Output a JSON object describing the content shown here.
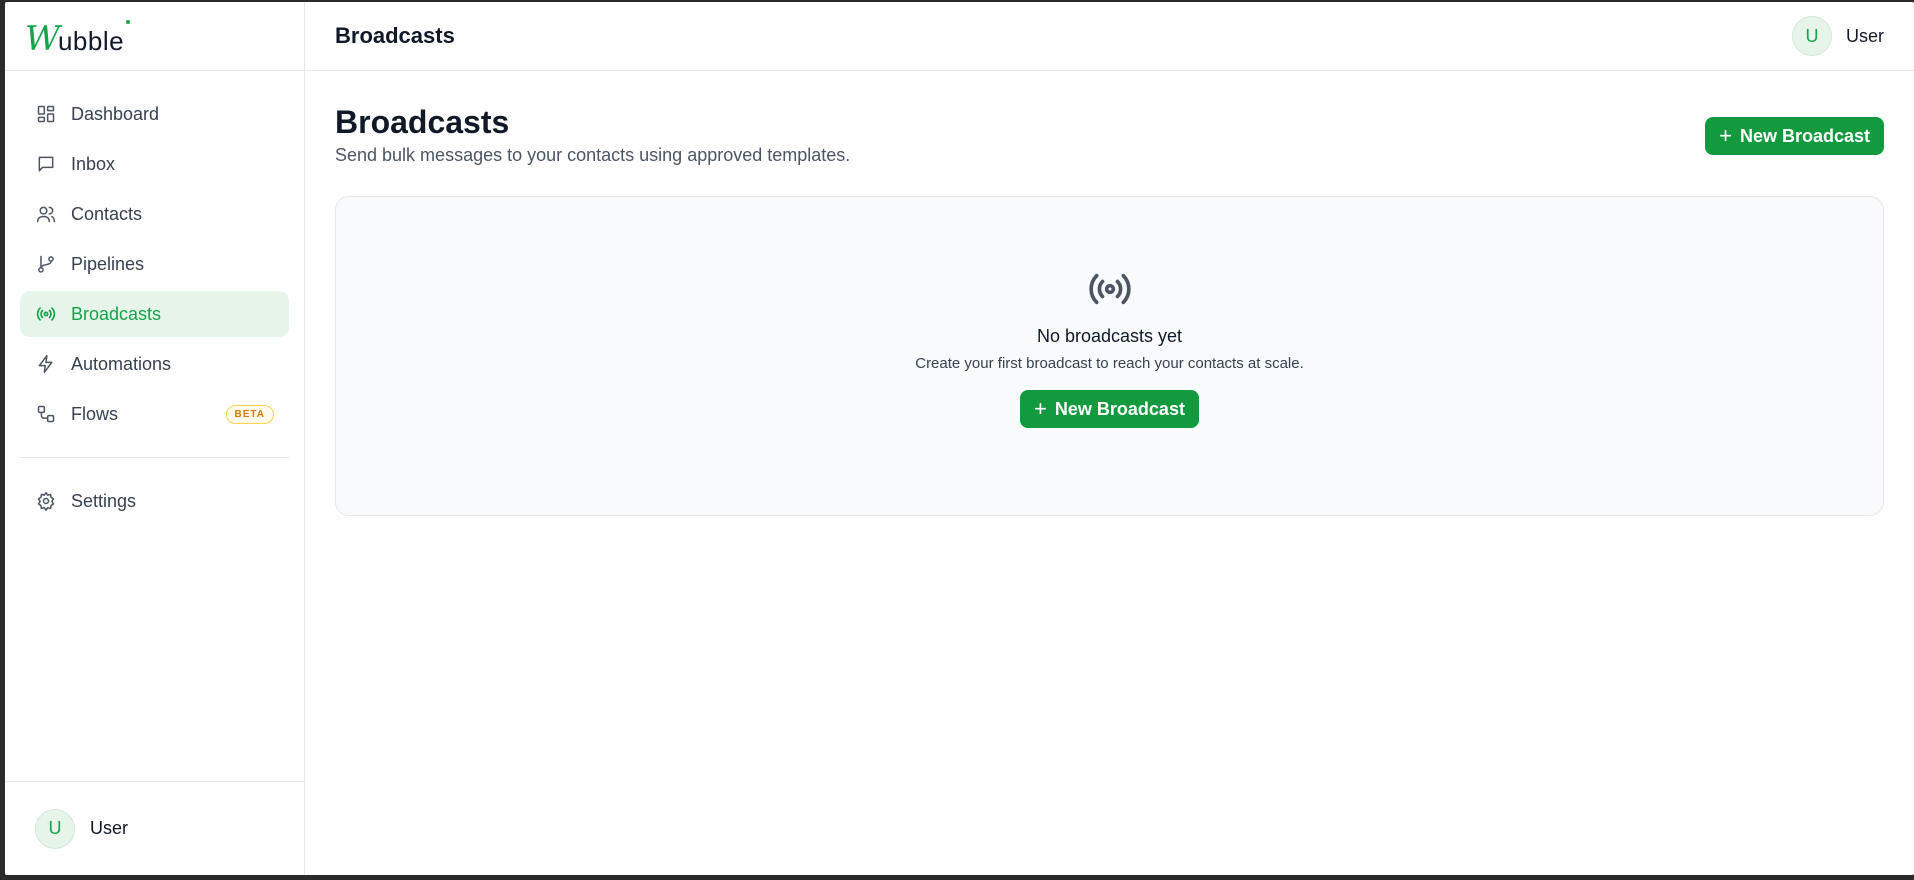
{
  "brand": {
    "logo_initial": "W",
    "logo_rest": "ubble"
  },
  "sidebar": {
    "items": [
      {
        "label": "Dashboard",
        "icon": "dashboard-icon"
      },
      {
        "label": "Inbox",
        "icon": "inbox-icon"
      },
      {
        "label": "Contacts",
        "icon": "contacts-icon"
      },
      {
        "label": "Pipelines",
        "icon": "pipelines-icon"
      },
      {
        "label": "Broadcasts",
        "icon": "broadcast-icon",
        "active": true
      },
      {
        "label": "Automations",
        "icon": "lightning-icon"
      },
      {
        "label": "Flows",
        "icon": "flows-icon",
        "badge": "BETA"
      }
    ],
    "settings_label": "Settings",
    "user": {
      "initial": "U",
      "name": "User"
    }
  },
  "topbar": {
    "title": "Broadcasts",
    "user": {
      "initial": "U",
      "name": "User"
    }
  },
  "page": {
    "title": "Broadcasts",
    "subtitle": "Send bulk messages to your contacts using approved templates.",
    "new_button_label": "New Broadcast"
  },
  "empty_state": {
    "title": "No broadcasts yet",
    "subtitle": "Create your first broadcast to reach your contacts at scale.",
    "button_label": "New Broadcast"
  },
  "colors": {
    "accent": "#16a34a",
    "active_bg": "#e6f4ea",
    "beta": "#d97706"
  }
}
